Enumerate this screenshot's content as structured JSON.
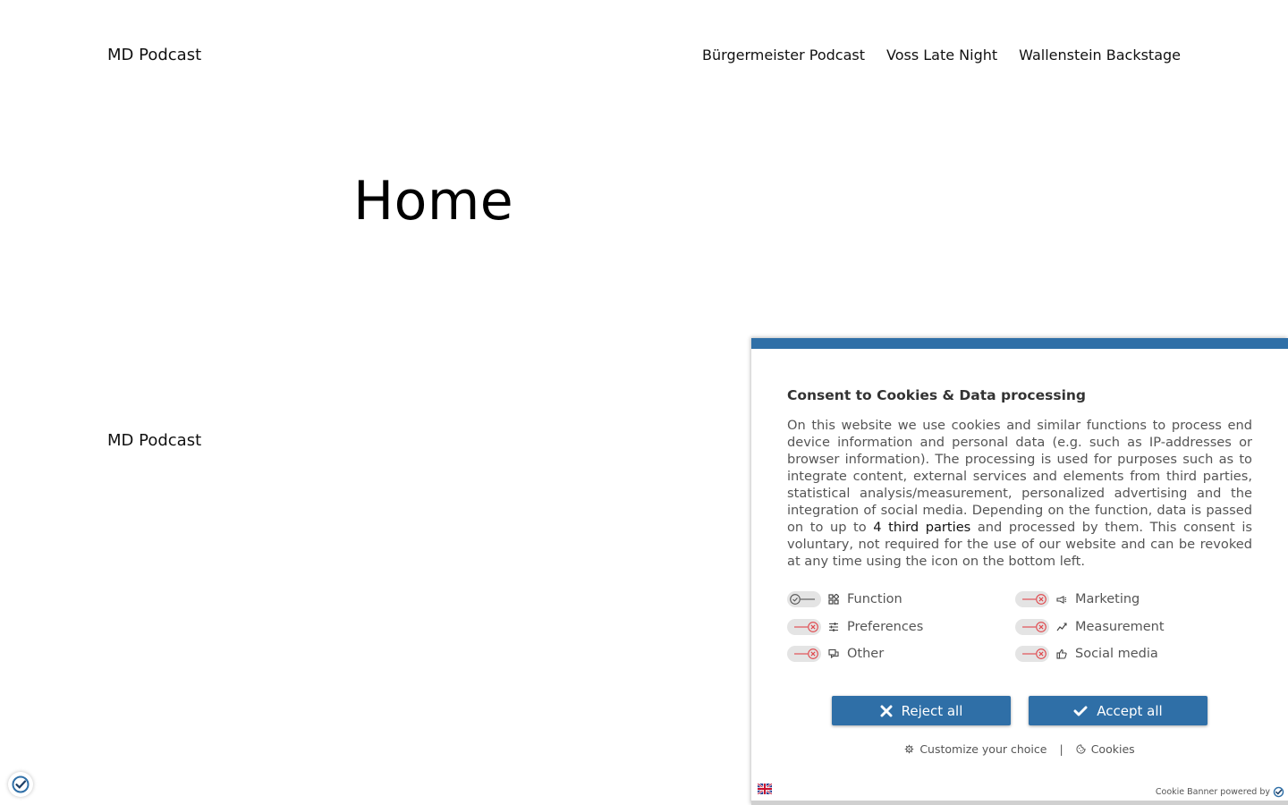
{
  "header": {
    "site_title": "MD Podcast",
    "nav": [
      {
        "label": "Bürgermeister Podcast"
      },
      {
        "label": "Voss Late Night"
      },
      {
        "label": "Wallenstein Backstage"
      }
    ]
  },
  "main": {
    "page_title": "Home"
  },
  "footer": {
    "site_title": "MD Podcast"
  },
  "consent": {
    "title": "Consent to Cookies & Data processing",
    "text_before": "On this website we use cookies and similar functions to process end device information and personal data (e.g. such as IP-addresses or browser information). The processing is used for purposes such as to integrate content, external services and elements from third parties, statistical analysis/measurement, personalized advertising and the integration of social media. Depending on the function, data is passed on to up to ",
    "third_parties_link": "4 third parties",
    "text_after": " and processed by them. This consent is voluntary, not required for the use of our website and can be revoked at any time using the icon on the bottom left.",
    "purposes": [
      {
        "label": "Function",
        "state": "on",
        "icon": "grid-icon"
      },
      {
        "label": "Marketing",
        "state": "off",
        "icon": "megaphone-icon"
      },
      {
        "label": "Preferences",
        "state": "off",
        "icon": "sliders-icon"
      },
      {
        "label": "Measurement",
        "state": "off",
        "icon": "chart-icon"
      },
      {
        "label": "Other",
        "state": "off",
        "icon": "chat-icon"
      },
      {
        "label": "Social media",
        "state": "off",
        "icon": "thumbs-up-icon"
      }
    ],
    "reject_label": "Reject all",
    "accept_label": "Accept all",
    "customize_label": "Customize your choice",
    "separator": "|",
    "cookies_label": "Cookies",
    "powered_label": "Cookie Banner powered by"
  },
  "colors": {
    "accent": "#2f6fa7",
    "toggle_off_mark": "#e0454a",
    "toggle_bg": "#e4e4e4"
  }
}
